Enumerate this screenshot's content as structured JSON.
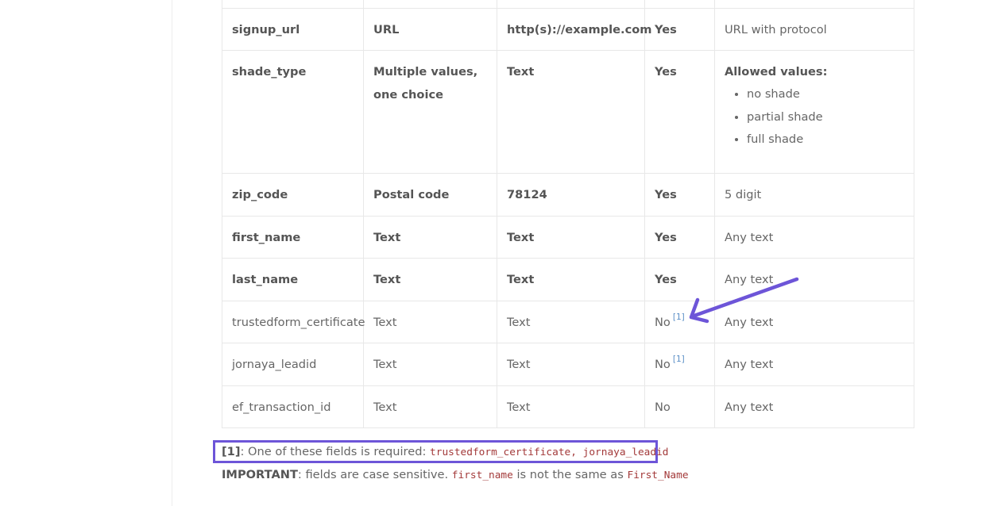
{
  "table": {
    "rows": [
      {
        "field": "signup_url",
        "type": "URL",
        "example": "http(s)://example.com",
        "required": "Yes",
        "notes": "URL with protocol",
        "style": "bold"
      },
      {
        "field": "shade_type",
        "type": "Multiple values, one choice",
        "example": "Text",
        "required": "Yes",
        "notes_title": "Allowed values:",
        "notes_list": [
          "no shade",
          "partial shade",
          "full shade"
        ],
        "style": "bold"
      },
      {
        "field": "zip_code",
        "type": "Postal code",
        "example": "78124",
        "required": "Yes",
        "notes": "5 digit",
        "style": "bold"
      },
      {
        "field": "first_name",
        "type": "Text",
        "example": "Text",
        "required": "Yes",
        "notes": "Any text",
        "style": "bold"
      },
      {
        "field": "last_name",
        "type": "Text",
        "example": "Text",
        "required": "Yes",
        "notes": "Any text",
        "style": "bold"
      },
      {
        "field": "trustedform_certificate",
        "type": "Text",
        "example": "Text",
        "required": "No",
        "footnote": "[1]",
        "notes": "Any text",
        "style": "normal"
      },
      {
        "field": "jornaya_leadid",
        "type": "Text",
        "example": "Text",
        "required": "No",
        "footnote": "[1]",
        "notes": "Any text",
        "style": "normal"
      },
      {
        "field": "ef_transaction_id",
        "type": "Text",
        "example": "Text",
        "required": "No",
        "notes": "Any text",
        "style": "normal"
      }
    ]
  },
  "footnotes": {
    "note1_marker": "[1]",
    "note1_text": ": One of these fields is required: ",
    "note1_code": "trustedform_certificate, jornaya_leadid",
    "important_label": "IMPORTANT",
    "important_text": ": fields are case sensitive. ",
    "important_code1": "first_name",
    "important_mid": " is not the same as ",
    "important_code2": "First_Name"
  },
  "colors": {
    "annotation": "#6d55d8",
    "code_text": "#a33a3a",
    "footnote_link": "#5b8fc7"
  }
}
